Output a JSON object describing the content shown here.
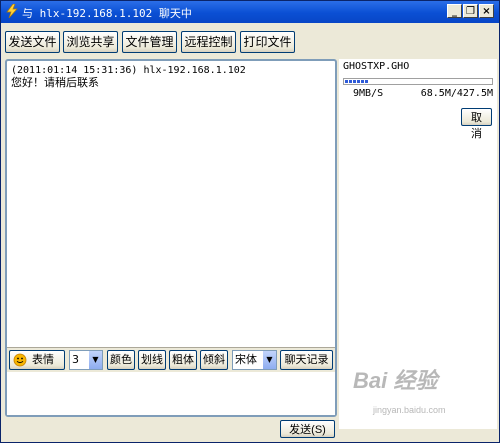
{
  "window": {
    "title": "与 hlx-192.168.1.102 聊天中",
    "controls": {
      "minimize": "_",
      "restore": "❐",
      "close": "×"
    }
  },
  "toolbar": {
    "buttons": [
      "发送文件",
      "浏览共享",
      "文件管理",
      "远程控制",
      "打印文件"
    ]
  },
  "chat": {
    "messages": [
      {
        "header": "(2011:01:14 15:31:36)   hlx-192.168.1.102",
        "text": "您好！请稍后联系"
      }
    ]
  },
  "format_bar": {
    "emoji_label": "表情",
    "font_size": "3",
    "color_label": "颜色",
    "underline_label": "划线",
    "bold_label": "粗体",
    "italic_label": "倾斜",
    "font_name": "宋体",
    "history_label": "聊天记录"
  },
  "transfer": {
    "filename": "GHOSTXP.GHO",
    "progress": 0.16,
    "speed": "9MB/S",
    "size": "68.5M/427.5M",
    "cancel_label": "取消"
  },
  "send_label": "发送(S)",
  "watermark": {
    "main": "Bai 经验",
    "sub": "jingyan.baidu.com"
  },
  "icons": {
    "title": "lightning-icon",
    "emoji": "smiley-icon"
  }
}
